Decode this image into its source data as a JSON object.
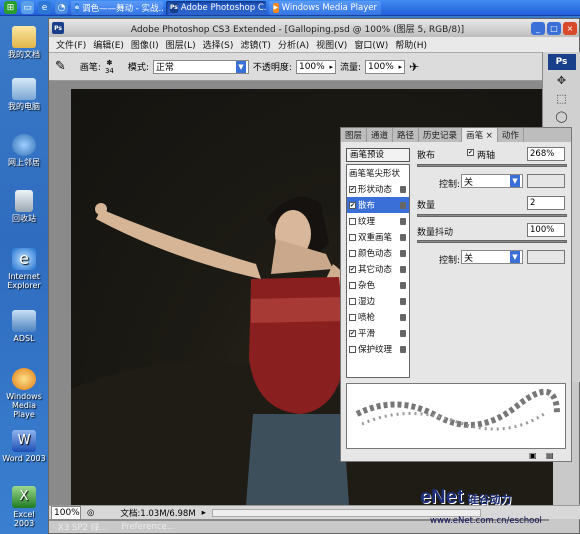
{
  "taskbar": {
    "tasks": [
      {
        "label": "调色——舞动 - 实战...",
        "active": false
      },
      {
        "label": "Adobe Photoshop C...",
        "active": true
      },
      {
        "label": "Windows Media Player",
        "active": false
      }
    ]
  },
  "desktop_icons": [
    {
      "label": "我的文档",
      "icon": "my-documents-icon"
    },
    {
      "label": "我的电脑",
      "icon": "my-computer-icon"
    },
    {
      "label": "网上邻居",
      "icon": "network-icon"
    },
    {
      "label": "回收站",
      "icon": "recycle-bin-icon"
    },
    {
      "label": "Internet Explorer",
      "icon": "ie-icon"
    },
    {
      "label": "ADSL",
      "icon": "adsl-icon"
    },
    {
      "label": "Windows Media Playe",
      "icon": "media-player-icon"
    },
    {
      "label": "Word 2003",
      "icon": "word-icon"
    },
    {
      "label": "Excel 2003",
      "icon": "excel-icon"
    }
  ],
  "ps": {
    "app_badge": "Ps",
    "title": "Adobe Photoshop CS3 Extended - [Galloping.psd @ 100% (图层 5, RGB/8)]",
    "menu": [
      "文件(F)",
      "编辑(E)",
      "图像(I)",
      "图层(L)",
      "选择(S)",
      "滤镜(T)",
      "分析(A)",
      "视图(V)",
      "窗口(W)",
      "帮助(H)"
    ],
    "options": {
      "brush_label": "画笔:",
      "brush_size": "34",
      "mode_label": "模式:",
      "mode_value": "正常",
      "opacity_label": "不透明度:",
      "opacity_value": "100%",
      "flow_label": "流量:",
      "flow_value": "100%"
    },
    "status": {
      "zoom": "100%",
      "doc": "文档:1.03M/6.98M"
    }
  },
  "panel": {
    "tabs": [
      "图层",
      "通道",
      "路径",
      "历史记录",
      "画笔 ×",
      "动作"
    ],
    "active_tab": 4,
    "presets_btn": "画笔预设",
    "brush_items": [
      {
        "label": "画笔笔尖形状",
        "check": "",
        "selected": false
      },
      {
        "label": "形状动态",
        "check": "✔",
        "selected": false
      },
      {
        "label": "散布",
        "check": "✔",
        "selected": true
      },
      {
        "label": "纹理",
        "check": "",
        "selected": false
      },
      {
        "label": "双重画笔",
        "check": "",
        "selected": false
      },
      {
        "label": "颜色动态",
        "check": "",
        "selected": false
      },
      {
        "label": "其它动态",
        "check": "✔",
        "selected": false
      },
      {
        "label": "杂色",
        "check": "",
        "selected": false
      },
      {
        "label": "湿边",
        "check": "",
        "selected": false
      },
      {
        "label": "喷枪",
        "check": "",
        "selected": false
      },
      {
        "label": "平滑",
        "check": "✔",
        "selected": false
      },
      {
        "label": "保护纹理",
        "check": "",
        "selected": false
      }
    ],
    "scatter_label": "散布",
    "both_axes_label": "两轴",
    "scatter_value": "268%",
    "control_label": "控制:",
    "control_value": "关",
    "count_label": "数量",
    "count_value": "2",
    "count_jitter_label": "数量抖动",
    "count_jitter_value": "100%",
    "control2_label": "控制:",
    "control2_value": "关"
  },
  "taskbar_bottom": {
    "item1": "X3 SP2 绿...",
    "item2": "Preference..."
  },
  "watermark": {
    "brand": "eNet",
    "suffix": "硅谷动力",
    "url": "www.eNet.com.cn/eschool"
  }
}
